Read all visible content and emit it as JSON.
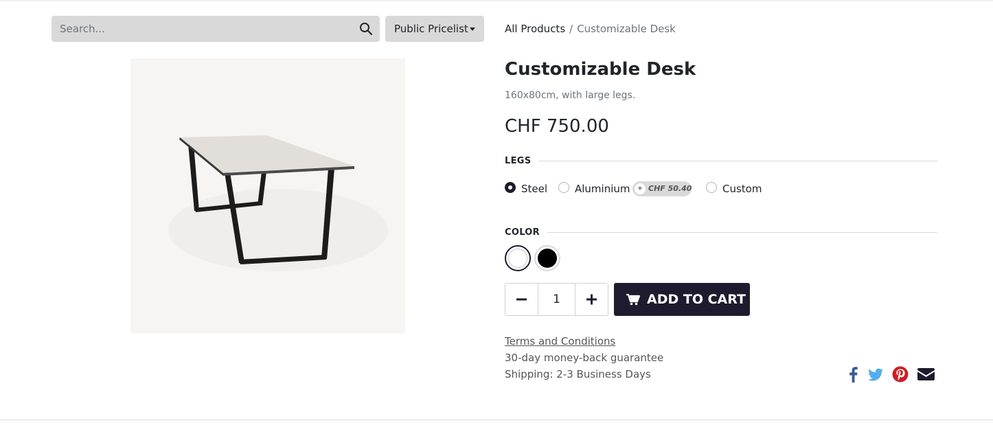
{
  "search": {
    "placeholder": "Search...",
    "value": ""
  },
  "pricelist": {
    "label": "Public Pricelist"
  },
  "breadcrumb": {
    "parent": "All Products",
    "separator": "/",
    "current": "Customizable Desk"
  },
  "product": {
    "name": "Customizable Desk",
    "description": "160x80cm, with large legs.",
    "price": "CHF 750.00"
  },
  "attributes": {
    "legs": {
      "label": "LEGS",
      "options": [
        {
          "label": "Steel",
          "checked": true
        },
        {
          "label": "Aluminium",
          "checked": false,
          "extra": "CHF 50.40",
          "extra_prefix": "+"
        },
        {
          "label": "Custom",
          "checked": false
        }
      ]
    },
    "color": {
      "label": "COLOR",
      "options": [
        {
          "name": "White",
          "hex": "#ffffff",
          "selected": true
        },
        {
          "name": "Black",
          "hex": "#000000",
          "selected": false
        }
      ]
    }
  },
  "quantity": {
    "value": "1"
  },
  "cart": {
    "label": "ADD TO CART"
  },
  "info": {
    "terms": "Terms and Conditions",
    "guarantee": "30-day money-back guarantee",
    "shipping": "Shipping: 2-3 Business Days"
  },
  "share": [
    "facebook-icon",
    "twitter-icon",
    "pinterest-icon",
    "email-icon"
  ],
  "colors": {
    "primary": "#1e1b2e",
    "facebook": "#3b5998",
    "twitter": "#55acee",
    "pinterest": "#cb2027",
    "email": "#1e1b2e"
  }
}
